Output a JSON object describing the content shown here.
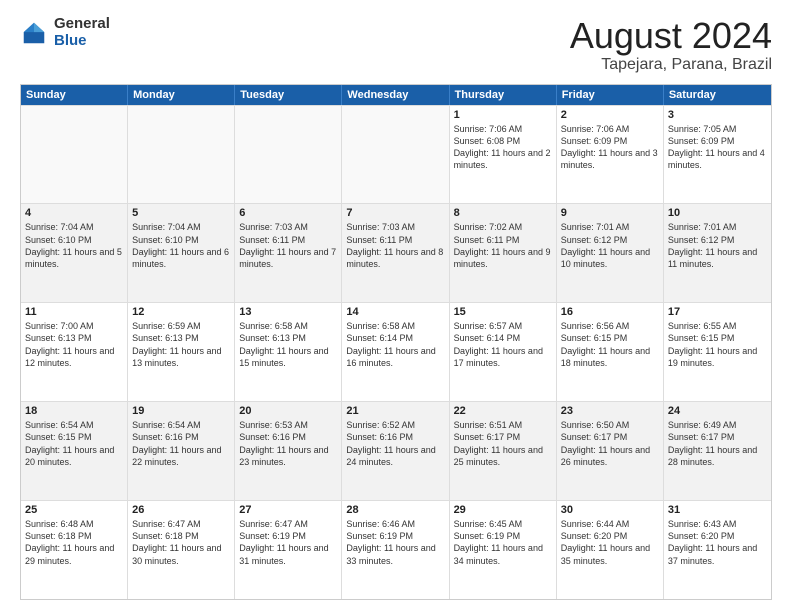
{
  "logo": {
    "general": "General",
    "blue": "Blue"
  },
  "title": "August 2024",
  "location": "Tapejara, Parana, Brazil",
  "days_of_week": [
    "Sunday",
    "Monday",
    "Tuesday",
    "Wednesday",
    "Thursday",
    "Friday",
    "Saturday"
  ],
  "rows": [
    [
      {
        "day": "",
        "info": ""
      },
      {
        "day": "",
        "info": ""
      },
      {
        "day": "",
        "info": ""
      },
      {
        "day": "",
        "info": ""
      },
      {
        "day": "1",
        "info": "Sunrise: 7:06 AM\nSunset: 6:08 PM\nDaylight: 11 hours\nand 2 minutes."
      },
      {
        "day": "2",
        "info": "Sunrise: 7:06 AM\nSunset: 6:09 PM\nDaylight: 11 hours\nand 3 minutes."
      },
      {
        "day": "3",
        "info": "Sunrise: 7:05 AM\nSunset: 6:09 PM\nDaylight: 11 hours\nand 4 minutes."
      }
    ],
    [
      {
        "day": "4",
        "info": "Sunrise: 7:04 AM\nSunset: 6:10 PM\nDaylight: 11 hours\nand 5 minutes."
      },
      {
        "day": "5",
        "info": "Sunrise: 7:04 AM\nSunset: 6:10 PM\nDaylight: 11 hours\nand 6 minutes."
      },
      {
        "day": "6",
        "info": "Sunrise: 7:03 AM\nSunset: 6:11 PM\nDaylight: 11 hours\nand 7 minutes."
      },
      {
        "day": "7",
        "info": "Sunrise: 7:03 AM\nSunset: 6:11 PM\nDaylight: 11 hours\nand 8 minutes."
      },
      {
        "day": "8",
        "info": "Sunrise: 7:02 AM\nSunset: 6:11 PM\nDaylight: 11 hours\nand 9 minutes."
      },
      {
        "day": "9",
        "info": "Sunrise: 7:01 AM\nSunset: 6:12 PM\nDaylight: 11 hours\nand 10 minutes."
      },
      {
        "day": "10",
        "info": "Sunrise: 7:01 AM\nSunset: 6:12 PM\nDaylight: 11 hours\nand 11 minutes."
      }
    ],
    [
      {
        "day": "11",
        "info": "Sunrise: 7:00 AM\nSunset: 6:13 PM\nDaylight: 11 hours\nand 12 minutes."
      },
      {
        "day": "12",
        "info": "Sunrise: 6:59 AM\nSunset: 6:13 PM\nDaylight: 11 hours\nand 13 minutes."
      },
      {
        "day": "13",
        "info": "Sunrise: 6:58 AM\nSunset: 6:13 PM\nDaylight: 11 hours\nand 15 minutes."
      },
      {
        "day": "14",
        "info": "Sunrise: 6:58 AM\nSunset: 6:14 PM\nDaylight: 11 hours\nand 16 minutes."
      },
      {
        "day": "15",
        "info": "Sunrise: 6:57 AM\nSunset: 6:14 PM\nDaylight: 11 hours\nand 17 minutes."
      },
      {
        "day": "16",
        "info": "Sunrise: 6:56 AM\nSunset: 6:15 PM\nDaylight: 11 hours\nand 18 minutes."
      },
      {
        "day": "17",
        "info": "Sunrise: 6:55 AM\nSunset: 6:15 PM\nDaylight: 11 hours\nand 19 minutes."
      }
    ],
    [
      {
        "day": "18",
        "info": "Sunrise: 6:54 AM\nSunset: 6:15 PM\nDaylight: 11 hours\nand 20 minutes."
      },
      {
        "day": "19",
        "info": "Sunrise: 6:54 AM\nSunset: 6:16 PM\nDaylight: 11 hours\nand 22 minutes."
      },
      {
        "day": "20",
        "info": "Sunrise: 6:53 AM\nSunset: 6:16 PM\nDaylight: 11 hours\nand 23 minutes."
      },
      {
        "day": "21",
        "info": "Sunrise: 6:52 AM\nSunset: 6:16 PM\nDaylight: 11 hours\nand 24 minutes."
      },
      {
        "day": "22",
        "info": "Sunrise: 6:51 AM\nSunset: 6:17 PM\nDaylight: 11 hours\nand 25 minutes."
      },
      {
        "day": "23",
        "info": "Sunrise: 6:50 AM\nSunset: 6:17 PM\nDaylight: 11 hours\nand 26 minutes."
      },
      {
        "day": "24",
        "info": "Sunrise: 6:49 AM\nSunset: 6:17 PM\nDaylight: 11 hours\nand 28 minutes."
      }
    ],
    [
      {
        "day": "25",
        "info": "Sunrise: 6:48 AM\nSunset: 6:18 PM\nDaylight: 11 hours\nand 29 minutes."
      },
      {
        "day": "26",
        "info": "Sunrise: 6:47 AM\nSunset: 6:18 PM\nDaylight: 11 hours\nand 30 minutes."
      },
      {
        "day": "27",
        "info": "Sunrise: 6:47 AM\nSunset: 6:19 PM\nDaylight: 11 hours\nand 31 minutes."
      },
      {
        "day": "28",
        "info": "Sunrise: 6:46 AM\nSunset: 6:19 PM\nDaylight: 11 hours\nand 33 minutes."
      },
      {
        "day": "29",
        "info": "Sunrise: 6:45 AM\nSunset: 6:19 PM\nDaylight: 11 hours\nand 34 minutes."
      },
      {
        "day": "30",
        "info": "Sunrise: 6:44 AM\nSunset: 6:20 PM\nDaylight: 11 hours\nand 35 minutes."
      },
      {
        "day": "31",
        "info": "Sunrise: 6:43 AM\nSunset: 6:20 PM\nDaylight: 11 hours\nand 37 minutes."
      }
    ]
  ]
}
